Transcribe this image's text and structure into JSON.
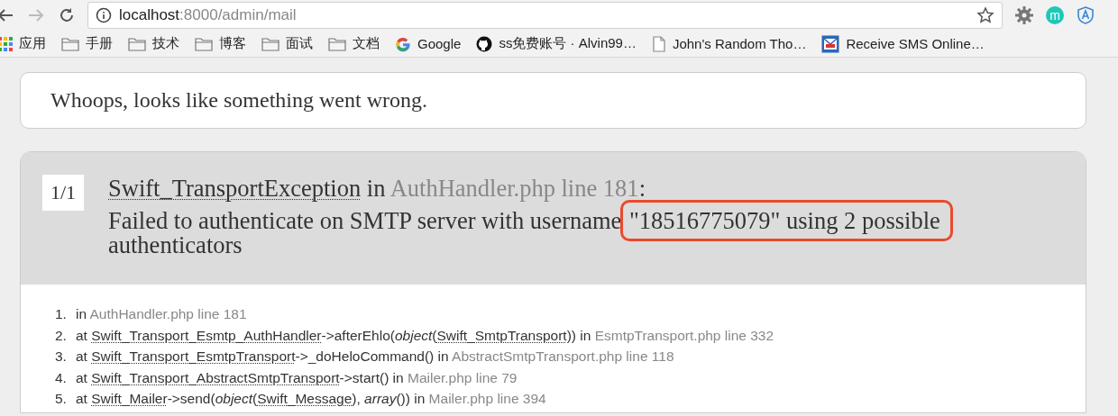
{
  "browser": {
    "url_host": "localhost",
    "url_path": ":8000/admin/mail",
    "extension_letter": "m"
  },
  "bookmarks": [
    {
      "kind": "apps",
      "label": "应用"
    },
    {
      "kind": "folder",
      "label": "手册"
    },
    {
      "kind": "folder",
      "label": "技术"
    },
    {
      "kind": "folder",
      "label": "博客"
    },
    {
      "kind": "folder",
      "label": "面试"
    },
    {
      "kind": "folder",
      "label": "文档"
    },
    {
      "kind": "google",
      "label": "Google"
    },
    {
      "kind": "github",
      "label": "ss免费账号 · Alvin99…"
    },
    {
      "kind": "page",
      "label": "John's Random Tho…"
    },
    {
      "kind": "sms",
      "label": "Receive SMS Online…"
    }
  ],
  "heading": "Whoops, looks like something went wrong.",
  "exception": {
    "counter": "1/1",
    "class": "Swift_TransportException",
    "connector": "in",
    "location": "AuthHandler.php line 181",
    "suffix": ":",
    "message": [
      {
        "text": "Failed to authenticate on SMTP server with username ",
        "highlighted": false
      },
      {
        "text": "\"18516775079\" using 2 possible",
        "highlighted": true
      },
      {
        "text": " authenticators",
        "highlighted": false
      }
    ]
  },
  "trace": [
    {
      "number": "1.",
      "segments": [
        {
          "kind": "text",
          "text": "in "
        },
        {
          "kind": "file",
          "text": "AuthHandler.php line 181"
        }
      ]
    },
    {
      "number": "2.",
      "segments": [
        {
          "kind": "text",
          "text": "at "
        },
        {
          "kind": "class",
          "text": "Swift_Transport_Esmtp_AuthHandler"
        },
        {
          "kind": "text",
          "text": "->afterEhlo("
        },
        {
          "kind": "italic",
          "text": "object"
        },
        {
          "kind": "text",
          "text": "("
        },
        {
          "kind": "class",
          "text": "Swift_SmtpTransport"
        },
        {
          "kind": "text",
          "text": ")) in "
        },
        {
          "kind": "file",
          "text": "EsmtpTransport.php line 332"
        }
      ]
    },
    {
      "number": "3.",
      "segments": [
        {
          "kind": "text",
          "text": "at "
        },
        {
          "kind": "class",
          "text": "Swift_Transport_EsmtpTransport"
        },
        {
          "kind": "text",
          "text": "->_doHeloCommand() in "
        },
        {
          "kind": "file",
          "text": "AbstractSmtpTransport.php line 118"
        }
      ]
    },
    {
      "number": "4.",
      "segments": [
        {
          "kind": "text",
          "text": "at "
        },
        {
          "kind": "class",
          "text": "Swift_Transport_AbstractSmtpTransport"
        },
        {
          "kind": "text",
          "text": "->start() in "
        },
        {
          "kind": "file",
          "text": "Mailer.php line 79"
        }
      ]
    },
    {
      "number": "5.",
      "segments": [
        {
          "kind": "text",
          "text": "at "
        },
        {
          "kind": "class",
          "text": "Swift_Mailer"
        },
        {
          "kind": "text",
          "text": "->send("
        },
        {
          "kind": "italic",
          "text": "object"
        },
        {
          "kind": "text",
          "text": "("
        },
        {
          "kind": "class",
          "text": "Swift_Message"
        },
        {
          "kind": "text",
          "text": "), "
        },
        {
          "kind": "italic",
          "text": "array"
        },
        {
          "kind": "text",
          "text": "()) in "
        },
        {
          "kind": "file",
          "text": "Mailer.php line 394"
        }
      ]
    }
  ]
}
